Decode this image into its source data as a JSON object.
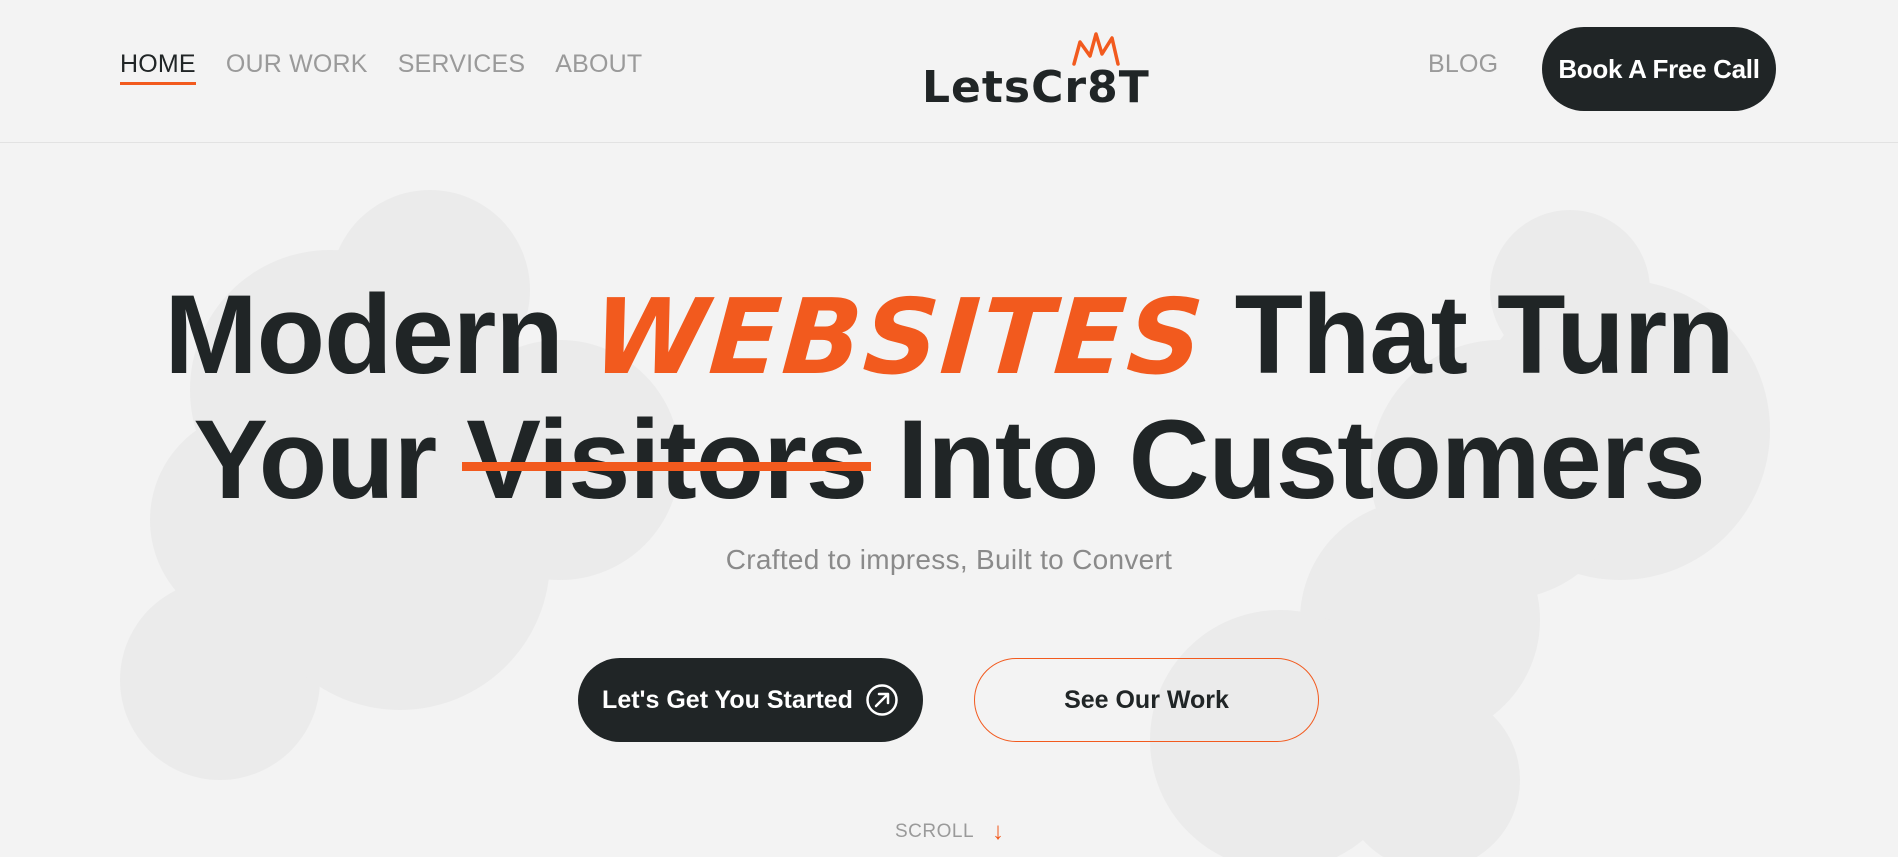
{
  "header": {
    "nav": [
      {
        "label": "HOME",
        "active": true
      },
      {
        "label": "OUR WORK",
        "active": false
      },
      {
        "label": "SERVICES",
        "active": false
      },
      {
        "label": "ABOUT",
        "active": false
      }
    ],
    "logo_text": "LetsCr8T",
    "blog_label": "BLOG",
    "cta_label": "Book A Free Call"
  },
  "hero": {
    "line1_before": "Modern",
    "line1_highlight": "WEBSITES",
    "line1_after": "That Turn",
    "line2_before": "Your",
    "line2_struck": "Visitors",
    "line2_after": "Into Customers",
    "subtitle": "Crafted to impress, Built to Convert",
    "primary_button": "Let's Get You Started",
    "secondary_button": "See Our Work",
    "scroll_label": "SCROLL"
  },
  "colors": {
    "accent": "#f25a1e",
    "dark": "#202526",
    "background": "#f3f3f3",
    "muted": "#9a9a9a"
  },
  "icons": [
    "crown-icon",
    "arrow-up-right-circle-icon",
    "arrow-down-icon"
  ]
}
